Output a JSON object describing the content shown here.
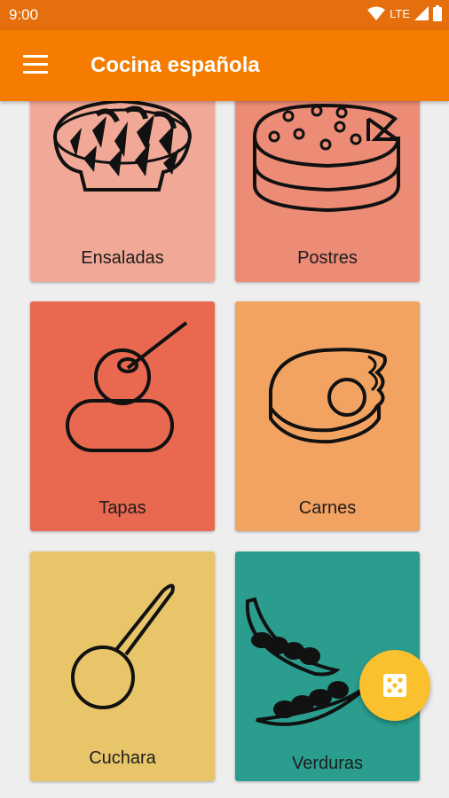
{
  "status_bar": {
    "time": "9:00",
    "network": "LTE",
    "icons": [
      "wifi-icon",
      "signal-icon",
      "battery-icon"
    ]
  },
  "app_bar": {
    "title": "Cocina española",
    "menu_icon": "menu-icon"
  },
  "categories": [
    {
      "label": "Ensaladas",
      "icon": "salad-bowl-icon",
      "color": "#f1a896"
    },
    {
      "label": "Postres",
      "icon": "cake-icon",
      "color": "#ec8b76"
    },
    {
      "label": "Tapas",
      "icon": "tapa-skewer-icon",
      "color": "#e8694f"
    },
    {
      "label": "Carnes",
      "icon": "meat-icon",
      "color": "#f2a361"
    },
    {
      "label": "Cuchara",
      "icon": "spoon-icon",
      "color": "#e9c56a"
    },
    {
      "label": "Verduras",
      "icon": "beans-icon",
      "color": "#2a9d8f"
    }
  ],
  "fab": {
    "icon": "dice-icon",
    "color": "#fbc02d"
  },
  "colors": {
    "status_bar": "#e56e0d",
    "app_bar": "#f57c00",
    "background": "#eeeeee"
  }
}
